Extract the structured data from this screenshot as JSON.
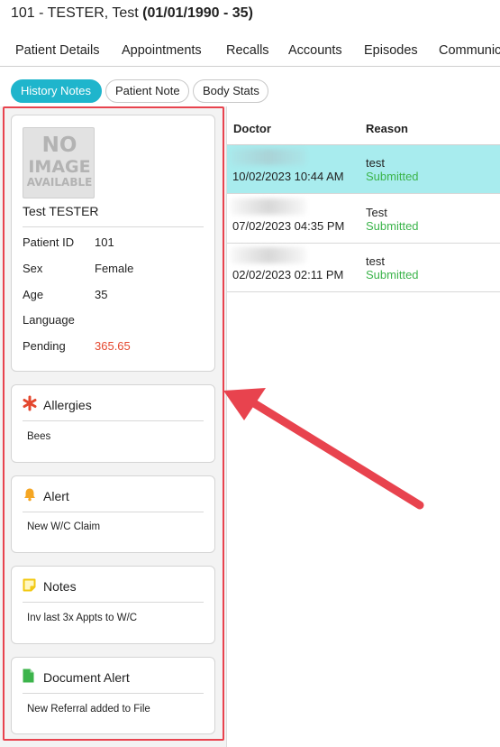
{
  "header": {
    "title_prefix": "101 - TESTER, Test ",
    "title_dob": "(01/01/1990 - 35)"
  },
  "nav": {
    "tabs": [
      "Patient Details",
      "Appointments",
      "Recalls",
      "Accounts",
      "Episodes",
      "Communic"
    ]
  },
  "subtabs": {
    "history_notes": "History Notes",
    "patient_note": "Patient Note",
    "body_stats": "Body Stats"
  },
  "patient": {
    "photo_text": [
      "NO",
      "IMAGE",
      "AVAILABLE"
    ],
    "name": "Test TESTER",
    "fields": [
      {
        "label": "Patient ID",
        "value": "101"
      },
      {
        "label": "Sex",
        "value": "Female"
      },
      {
        "label": "Age",
        "value": "35"
      },
      {
        "label": "Language",
        "value": ""
      },
      {
        "label": "Pending",
        "value": "365.65"
      }
    ]
  },
  "cards": {
    "allergies": {
      "title": "Allergies",
      "body": "Bees",
      "icon": "asterisk-icon",
      "color": "#e4472e"
    },
    "alert": {
      "title": "Alert",
      "body": "New W/C Claim",
      "icon": "bell-icon",
      "color": "#f5a623"
    },
    "notes": {
      "title": "Notes",
      "body": "Inv last 3x Appts to W/C",
      "icon": "sticky-note-icon",
      "color": "#f2c811"
    },
    "document_alert": {
      "title": "Document Alert",
      "body": "New Referral added to File",
      "icon": "document-icon",
      "color": "#3cb44b"
    }
  },
  "history_table": {
    "columns": {
      "doctor": "Doctor",
      "reason": "Reason"
    },
    "rows": [
      {
        "date": "10/02/2023 10:44 AM",
        "reason": "test",
        "status": "Submitted",
        "selected": true
      },
      {
        "date": "07/02/2023 04:35 PM",
        "reason": "Test",
        "status": "Submitted",
        "selected": false
      },
      {
        "date": "02/02/2023 02:11 PM",
        "reason": "test",
        "status": "Submitted",
        "selected": false
      }
    ]
  },
  "colors": {
    "accent": "#1fb5cc",
    "selected_row": "#a8ecee",
    "status_green": "#3cb44b",
    "pending_red": "#e4472e",
    "annotation_red": "#e8434e"
  }
}
